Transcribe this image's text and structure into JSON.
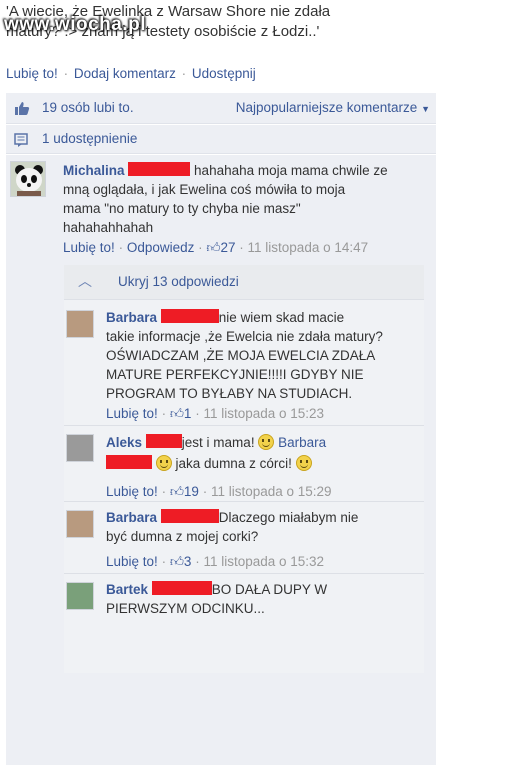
{
  "post": {
    "text_line1": "'A wiecie, że Ewelinka z Warsaw Shore nie zdała",
    "text_line2": "matury? :> znam ją i testety osobiście z Łodzi..'",
    "watermark": "www.wiocha.pl"
  },
  "actions": {
    "like": "Lubię to!",
    "comment": "Dodaj komentarz",
    "share": "Udostępnij"
  },
  "likes_row": {
    "text": "19 osób lubi to.",
    "sort": "Najpopularniejsze komentarze"
  },
  "shares_row": {
    "text": "1 udostępnienie"
  },
  "main_comment": {
    "author": "Michalina",
    "text_line1": "hahahaha moja mama chwile ze",
    "text_line2": "mną oglądała, i jak Ewelina coś mówiła to moja",
    "text_line3": "mama \"no matury to ty chyba nie masz\"",
    "text_line4": "hahahahhahah",
    "like": "Lubię to!",
    "reply": "Odpowiedz",
    "likes": "27",
    "date": "11 listopada o 14:47"
  },
  "hide_replies": "Ukryj 13 odpowiedzi",
  "replies": [
    {
      "author": "Barbara",
      "lines": [
        "nie wiem skad macie",
        "takie informacje ,że Ewelcia nie zdała matury?",
        "OŚWIADCZAM ,ŻE MOJA EWELCIA ZDAŁA",
        "MATURE PERFEKCYJNIE!!!!I GDYBY NIE",
        "PROGRAM TO BYŁABY NA STUDIACH."
      ],
      "like": "Lubię to!",
      "likes": "1",
      "date": "11 listopada o 15:23"
    },
    {
      "author": "Aleks",
      "line1_a": "jest i mama!",
      "line1_b": "Barbara",
      "line2": "jaka dumna z córci!",
      "like": "Lubię to!",
      "likes": "19",
      "date": "11 listopada o 15:29"
    },
    {
      "author": "Barbara",
      "lines": [
        "Dlaczego miałabym nie",
        "być dumna z mojej corki?"
      ],
      "like": "Lubię to!",
      "likes": "3",
      "date": "11 listopada o 15:32"
    },
    {
      "author": "Bartek",
      "lines": [
        "BO DAŁA DUPY W",
        "PIERWSZYM ODCINKU..."
      ]
    }
  ],
  "colors": {
    "link": "#3b5998",
    "panel": "#edeff4",
    "redaction": "#ee1c25"
  }
}
